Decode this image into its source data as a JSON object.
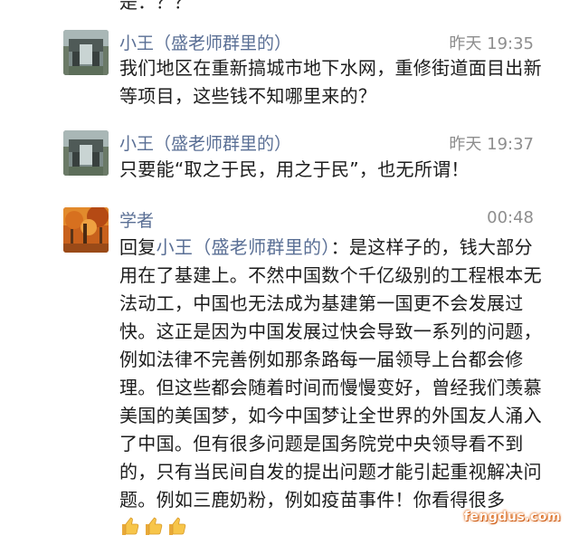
{
  "cut_off_text": "是：？？",
  "comments": [
    {
      "name": "小王（盛老师群里的）",
      "time": "昨天 19:35",
      "text": "我们地区在重新搞城市地下水网，重修街道面目出新等项目，这些钱不知哪里来的？"
    },
    {
      "name": "小王（盛老师群里的）",
      "time": "昨天 19:37",
      "text": "只要能“取之于民，用之于民”，也无所谓！"
    },
    {
      "name": "学者",
      "time": "00:48",
      "reply_prefix": "回复",
      "reply_target": "小王（盛老师群里的）",
      "text": "：是这样子的，钱大部分用在了基建上。不然中国数个千亿级别的工程根本无法动工，中国也无法成为基建第一国更不会发展过快。这正是因为中国发展过快会导致一系列的问题，例如法律不完善例如那条路每一届领导上台都会修理。但这些都会随着时间而慢慢变好，曾经我们羡慕美国的美国梦，如今中国梦让全世界的外国友人涌入了中国。但有很多问题是国务院党中央领导看不到的，只有当民间自发的提出问题才能引起重视解决问题。例如三鹿奶粉，例如疫苗事件！你看得很多",
      "emoji": [
        "thumbs-up",
        "thumbs-up",
        "thumbs-up"
      ]
    }
  ],
  "watermark": "fengdus.com",
  "colors": {
    "name": "#5a6f95",
    "time": "#8e8e8e",
    "text": "#1c1c1c"
  }
}
